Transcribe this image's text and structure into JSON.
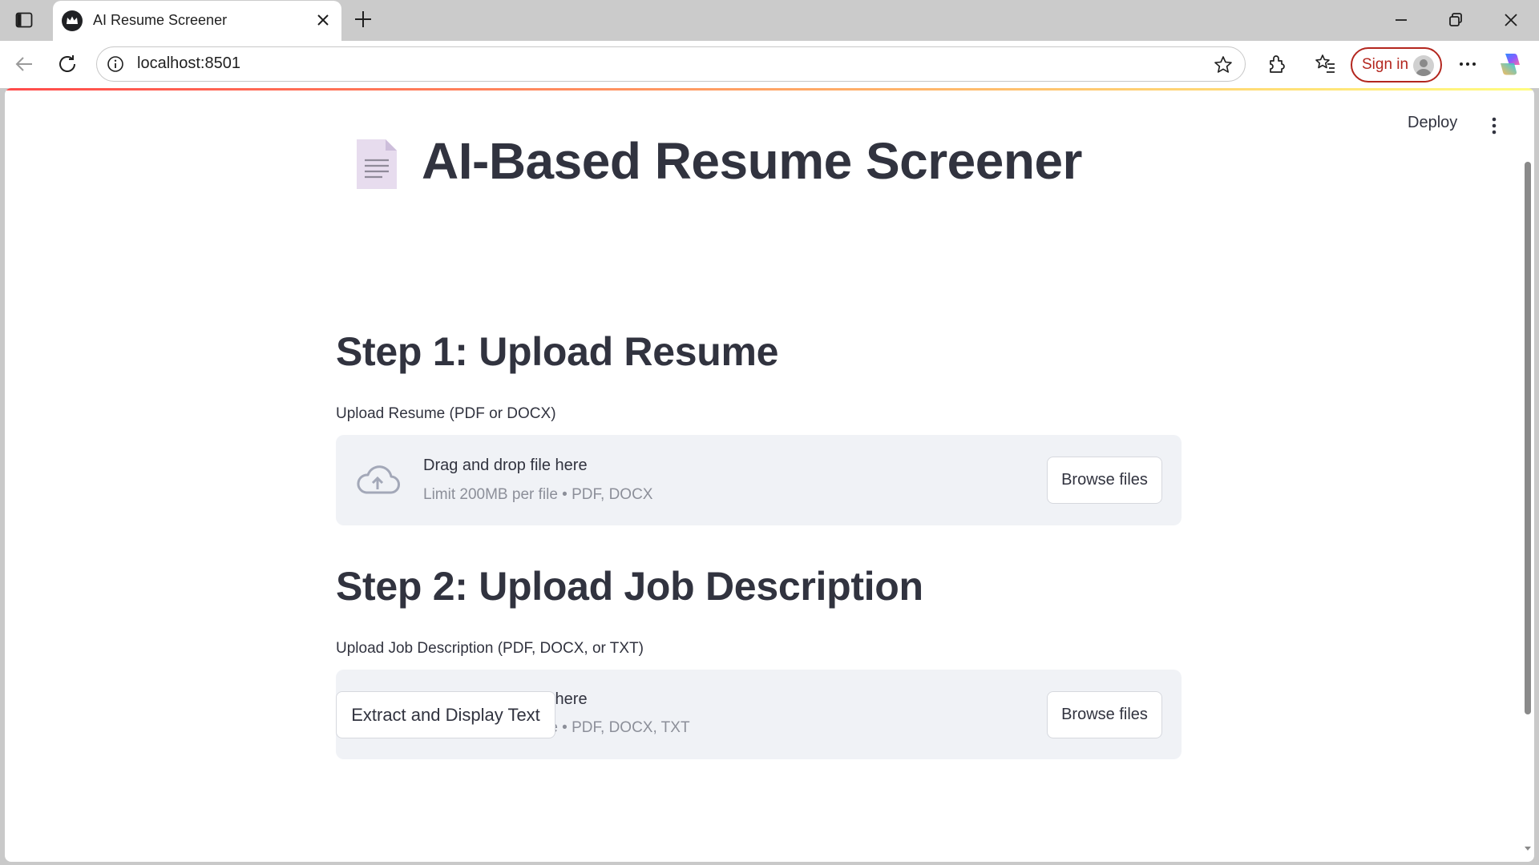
{
  "browser": {
    "tab_title": "AI Resume Screener",
    "url": "localhost:8501",
    "sign_in_label": "Sign in",
    "icons": [
      "sidebar-toggle-icon",
      "crown-favicon-icon",
      "close-icon",
      "plus-icon",
      "minimize-icon",
      "restore-icon",
      "close-window-icon",
      "back-icon",
      "reload-icon",
      "info-icon",
      "star-icon",
      "extensions-icon",
      "favorites-icon",
      "more-icon",
      "copilot-icon"
    ]
  },
  "app_header": {
    "deploy_label": "Deploy",
    "menu_icon": "vertical-ellipsis-icon"
  },
  "main": {
    "title_emoji": "page-facing-up",
    "title": "AI-Based Resume Screener",
    "step1": {
      "heading": "Step 1: Upload Resume",
      "label": "Upload Resume (PDF or DOCX)",
      "drop_title": "Drag and drop file here",
      "drop_sub": "Limit 200MB per file • PDF, DOCX",
      "browse_label": "Browse files"
    },
    "step2": {
      "heading": "Step 2: Upload Job Description",
      "label": "Upload Job Description (PDF, DOCX, or TXT)",
      "drop_title": "Drag and drop file here",
      "drop_sub": "Limit 200MB per file • PDF, DOCX, TXT",
      "browse_label": "Browse files"
    },
    "extract_label": "Extract and Display Text"
  },
  "colors": {
    "accent_red": "#ff4b4b",
    "accent_yellow": "#fffd80",
    "text": "#31333f",
    "dropzone_bg": "#f0f2f6",
    "muted": "#8c8f99",
    "sign_in_red": "#b3261e"
  }
}
